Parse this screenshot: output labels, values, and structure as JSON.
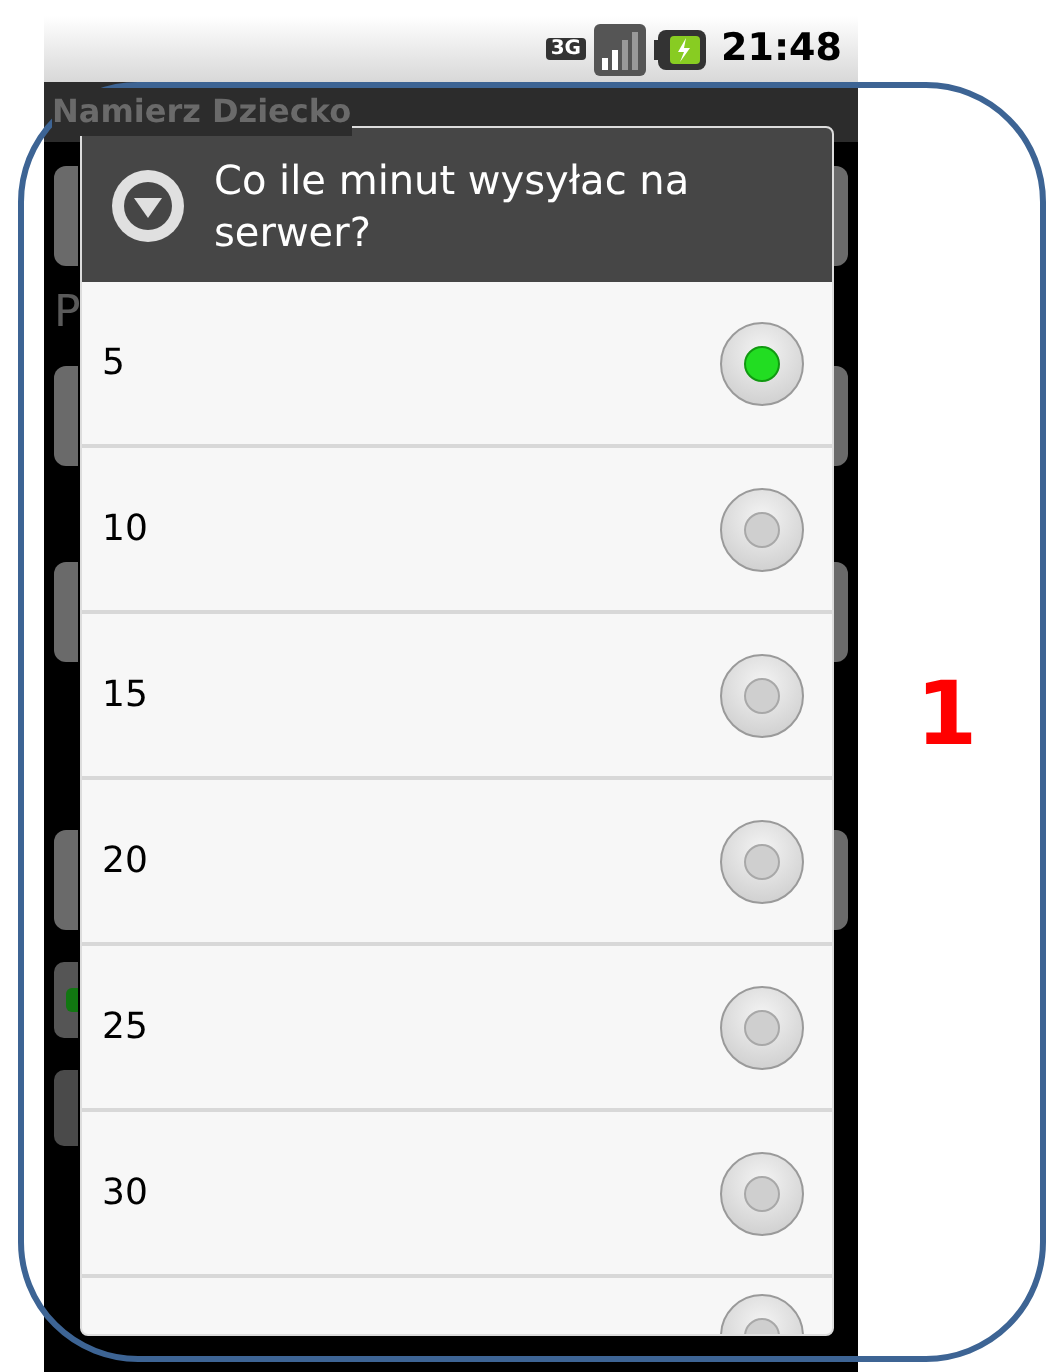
{
  "status_bar": {
    "time": "21:48",
    "network": "3G"
  },
  "app": {
    "title": "Namierz Dziecko",
    "content": [
      {
        "kind": "field"
      },
      {
        "kind": "label",
        "text": "P"
      },
      {
        "kind": "field"
      },
      {
        "kind": "gap"
      },
      {
        "kind": "field"
      },
      {
        "kind": "gap"
      },
      {
        "kind": "gap"
      },
      {
        "kind": "field"
      },
      {
        "kind": "checkbox",
        "checked": true
      },
      {
        "kind": "checkbox",
        "checked": false
      }
    ]
  },
  "dialog": {
    "title": "Co ile minut wysyłac na serwer?",
    "options": [
      {
        "label": "5",
        "selected": true
      },
      {
        "label": "10",
        "selected": false
      },
      {
        "label": "15",
        "selected": false
      },
      {
        "label": "20",
        "selected": false
      },
      {
        "label": "25",
        "selected": false
      },
      {
        "label": "30",
        "selected": false
      },
      {
        "selected": false
      }
    ]
  },
  "annotation": {
    "label": "1"
  }
}
